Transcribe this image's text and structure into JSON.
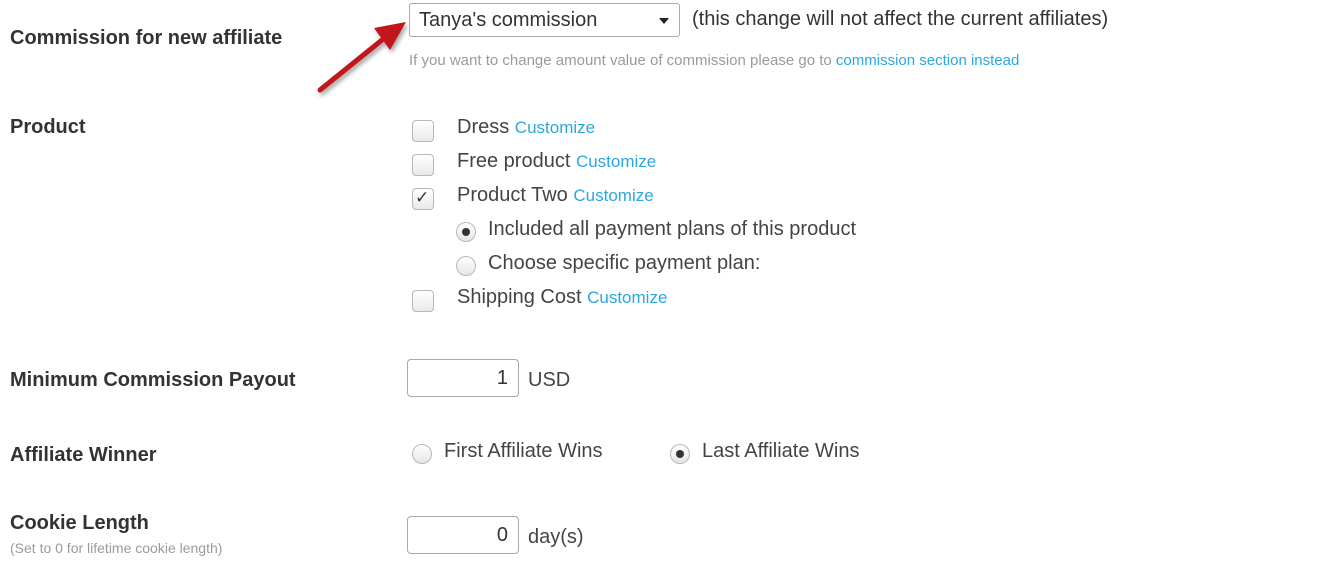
{
  "commission": {
    "label": "Commission for new affiliate",
    "selected": "Tanya's commission",
    "note": "(this change will not affect the current affiliates)",
    "hint_prefix": "If you want to change amount value of commission please go to",
    "hint_link": "commission section instead"
  },
  "product": {
    "label": "Product",
    "customize_label": "Customize",
    "items": [
      {
        "name": "Dress",
        "checked": false
      },
      {
        "name": "Free product",
        "checked": false
      },
      {
        "name": "Product Two",
        "checked": true
      },
      {
        "name": "Shipping Cost",
        "checked": false
      }
    ],
    "payment_plans": [
      {
        "label": "Included all payment plans of this product",
        "selected": true
      },
      {
        "label": "Choose specific payment plan:",
        "selected": false
      }
    ]
  },
  "payout": {
    "label": "Minimum Commission Payout",
    "value": "1",
    "unit": "USD"
  },
  "winner": {
    "label": "Affiliate Winner",
    "options": [
      {
        "label": "First Affiliate Wins",
        "selected": false
      },
      {
        "label": "Last Affiliate Wins",
        "selected": true
      }
    ]
  },
  "cookie": {
    "label": "Cookie Length",
    "hint": "(Set to 0 for lifetime cookie length)",
    "value": "0",
    "unit": "day(s)"
  },
  "colors": {
    "link": "#2aa7e0",
    "arrow": "#c0161b"
  }
}
